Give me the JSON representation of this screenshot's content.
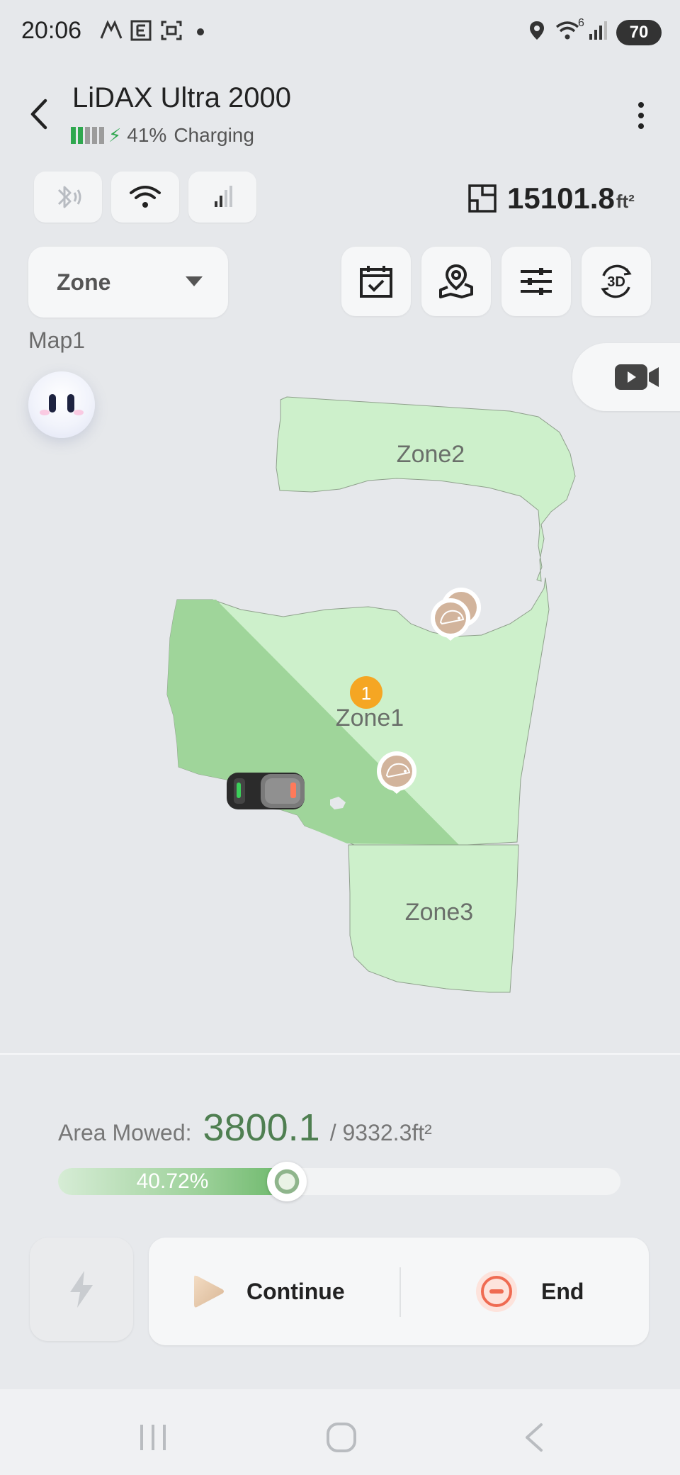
{
  "status_bar": {
    "time": "20:06",
    "battery": "70",
    "notification_icons": [
      "A-icon",
      "E-icon",
      "screenshot-icon",
      "dot-icon"
    ],
    "system_icons": [
      "location-icon",
      "wifi-icon",
      "signal-icon",
      "battery-icon"
    ],
    "wifi_badge": "6"
  },
  "header": {
    "title": "LiDAX Ultra 2000",
    "battery_percent": "41%",
    "charge_status": "Charging",
    "battery_bars_on": 2,
    "battery_bars_total": 5
  },
  "connectivity": {
    "chips": [
      "bluetooth-icon",
      "wifi-icon",
      "cellular-signal-icon"
    ],
    "total_area": "15101.8",
    "total_area_unit": "ft²"
  },
  "mode_select": {
    "selected": "Zone"
  },
  "toolbar": {
    "tools": [
      "calendar-check-icon",
      "map-pin-icon",
      "settings-sliders-icon",
      "3d-view-icon"
    ]
  },
  "map": {
    "name": "Map1",
    "zones": [
      {
        "label": "Zone2"
      },
      {
        "label": "Zone1",
        "order_badge": "1"
      },
      {
        "label": "Zone3"
      }
    ],
    "camera_icon": "video-camera-icon"
  },
  "mowing": {
    "area_label": "Area Mowed:",
    "area_mowed": "3800.1",
    "area_total": "/ 9332.3ft²",
    "progress_text": "40.72%",
    "progress_fraction": 0.4072
  },
  "controls": {
    "continue_label": "Continue",
    "end_label": "End"
  },
  "colors": {
    "zone_fill": "#cdf0cb",
    "mowed_fill": "#9fd59a",
    "accent_green": "#4f7f51",
    "battery_green": "#2fa84f",
    "badge_orange": "#f5a623",
    "end_red": "#ef6b52"
  }
}
